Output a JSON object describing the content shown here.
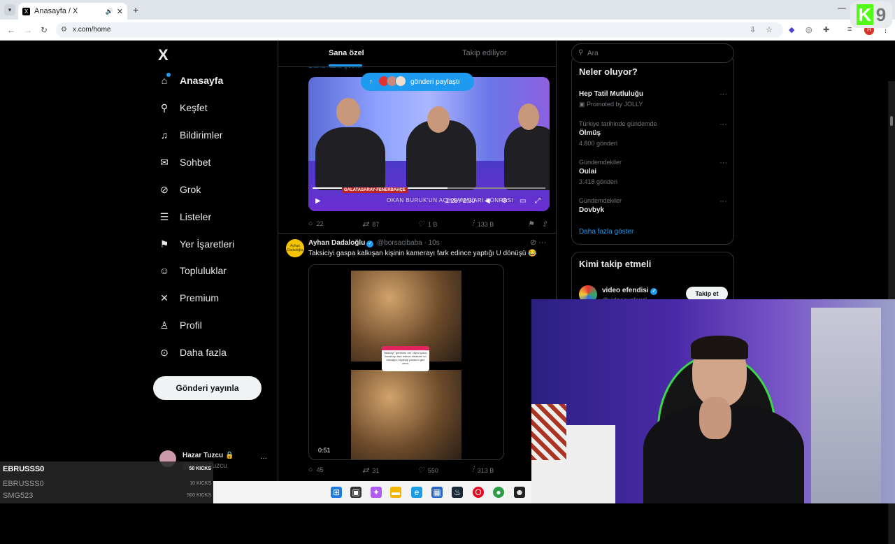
{
  "browser": {
    "tab_title": "Anasayfa / X",
    "tab_favicon": "X",
    "url": "x.com/home",
    "overlay_badge": {
      "letter": "K",
      "number": "9"
    },
    "profile_initial": "H"
  },
  "sidebar": {
    "logo": "X",
    "items": [
      {
        "label": "Anasayfa",
        "icon": "home-icon"
      },
      {
        "label": "Keşfet",
        "icon": "search-icon"
      },
      {
        "label": "Bildirimler",
        "icon": "bell-icon"
      },
      {
        "label": "Sohbet",
        "icon": "mail-icon"
      },
      {
        "label": "Grok",
        "icon": "grok-icon"
      },
      {
        "label": "Listeler",
        "icon": "list-icon"
      },
      {
        "label": "Yer İşaretleri",
        "icon": "bookmark-icon"
      },
      {
        "label": "Topluluklar",
        "icon": "people-icon"
      },
      {
        "label": "Premium",
        "icon": "x-icon"
      },
      {
        "label": "Profil",
        "icon": "user-icon"
      },
      {
        "label": "Daha fazla",
        "icon": "more-circle-icon"
      }
    ],
    "post_button": "Gönderi yayınla",
    "account": {
      "name": "Hazar Tuzcu 🔒",
      "handle": "@HazarTuzcu"
    }
  },
  "feed": {
    "tabs": [
      "Sana özel",
      "Takip ediliyor"
    ],
    "show_more": "Daha fazla göster",
    "share_pill": "gönderi paylaştı",
    "video1": {
      "ticker": "GALATASARAY-FENERBAHÇE",
      "subtitle": "OKAN BURUK'UN AÇIKLAMALARI SONRASI",
      "time": "1:28 / 2:30"
    },
    "tweet1_stats": {
      "replies": "22",
      "reposts": "87",
      "likes": "1 B",
      "views": "133 B"
    },
    "tweet2": {
      "name": "Ayhan Dadaloğlu",
      "handle": "@borsacibaba",
      "time": "· 10s",
      "avatar_text": "Ayhan Dadaloğlu",
      "text": "Taksiciyi gaspa kalkışan kişinin kamerayı fark edince yaptığı U dönüşü 😂",
      "video_duration": "0:51",
      "caption": "Taksiciyi \"gerekeni var\" diyen yolcu, kamerayı fark edince dilcilerini no olacağını söyleyip parasını geri verdi.",
      "stats": {
        "replies": "45",
        "reposts": "31",
        "likes": "550",
        "views": "313 B"
      }
    }
  },
  "right": {
    "search_placeholder": "Ara",
    "trends_title": "Neler oluyor?",
    "trends": [
      {
        "context": "",
        "title": "Hep Tatil Mutluluğu",
        "count": "Promoted by JOLLY"
      },
      {
        "context": "Türkiye tarihinde gündemde",
        "title": "Ölmüş",
        "count": "4.800 gönderi"
      },
      {
        "context": "Gündemdekiler",
        "title": "Oulai",
        "count": "3.418 gönderi"
      },
      {
        "context": "Gündemdekiler",
        "title": "Dovbyk",
        "count": ""
      }
    ],
    "trends_more": "Daha fazla göster",
    "follow_title": "Kimi takip etmeli",
    "follow": {
      "name": "video efendisi",
      "handle": "@videocuefendi",
      "button": "Takip et"
    }
  },
  "kick_overlay": [
    {
      "name": "EBRUSSS0",
      "value": "50 KICKS"
    },
    {
      "name": "EBRUSSS0",
      "value": "10 KICKS"
    },
    {
      "name": "SMG523",
      "value": "500 KICKS"
    }
  ],
  "taskbar_icons": [
    "windows-icon",
    "files-icon",
    "copilot-icon",
    "folder-icon",
    "edge-icon",
    "store-icon",
    "steam-icon",
    "opera-icon",
    "chrome-icon",
    "discord-icon"
  ]
}
